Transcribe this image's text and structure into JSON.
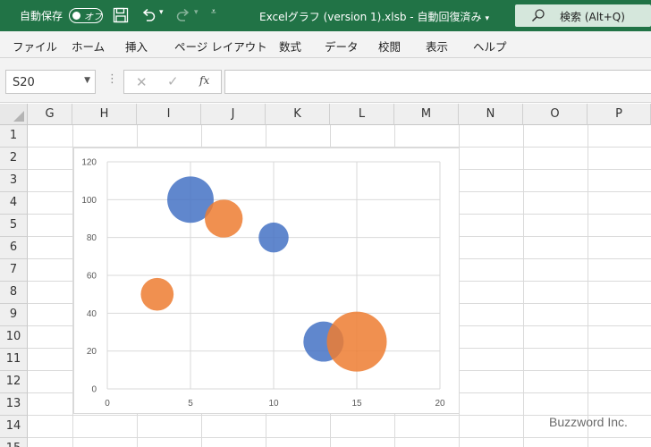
{
  "titlebar": {
    "autosave_label": "自動保存",
    "autosave_state": "オフ",
    "title": "Excelグラフ (version 1).xlsb - 自動回復済み",
    "search_label": "検索 (Alt+Q)"
  },
  "ribbon": {
    "tabs": [
      "ファイル",
      "ホーム",
      "挿入",
      "ページ レイアウト",
      "数式",
      "データ",
      "校閲",
      "表示",
      "ヘルプ"
    ]
  },
  "formula_bar": {
    "name_box": "S20",
    "fx_label": "fx",
    "formula": ""
  },
  "sheet": {
    "columns": [
      "G",
      "H",
      "I",
      "J",
      "K",
      "L",
      "M",
      "N",
      "O",
      "P"
    ],
    "rows": [
      "1",
      "2",
      "3",
      "4",
      "5",
      "6",
      "7",
      "8",
      "9",
      "10",
      "11",
      "12",
      "13",
      "14",
      "15"
    ]
  },
  "chart_data": {
    "type": "bubble",
    "xlim": [
      0,
      20
    ],
    "ylim": [
      0,
      120
    ],
    "x_ticks": [
      0,
      5,
      10,
      15,
      20
    ],
    "y_ticks": [
      0,
      20,
      40,
      60,
      80,
      100,
      120
    ],
    "grid": true,
    "legend": "none",
    "series": [
      {
        "color": "#4472C4",
        "points": [
          {
            "x": 5,
            "y": 100,
            "size": 60
          },
          {
            "x": 10,
            "y": 80,
            "size": 25
          },
          {
            "x": 13,
            "y": 25,
            "size": 45
          }
        ]
      },
      {
        "color": "#ED7D31",
        "points": [
          {
            "x": 7,
            "y": 90,
            "size": 40
          },
          {
            "x": 3,
            "y": 50,
            "size": 30
          },
          {
            "x": 15,
            "y": 25,
            "size": 100
          }
        ]
      }
    ]
  },
  "watermark": "Buzzword Inc."
}
